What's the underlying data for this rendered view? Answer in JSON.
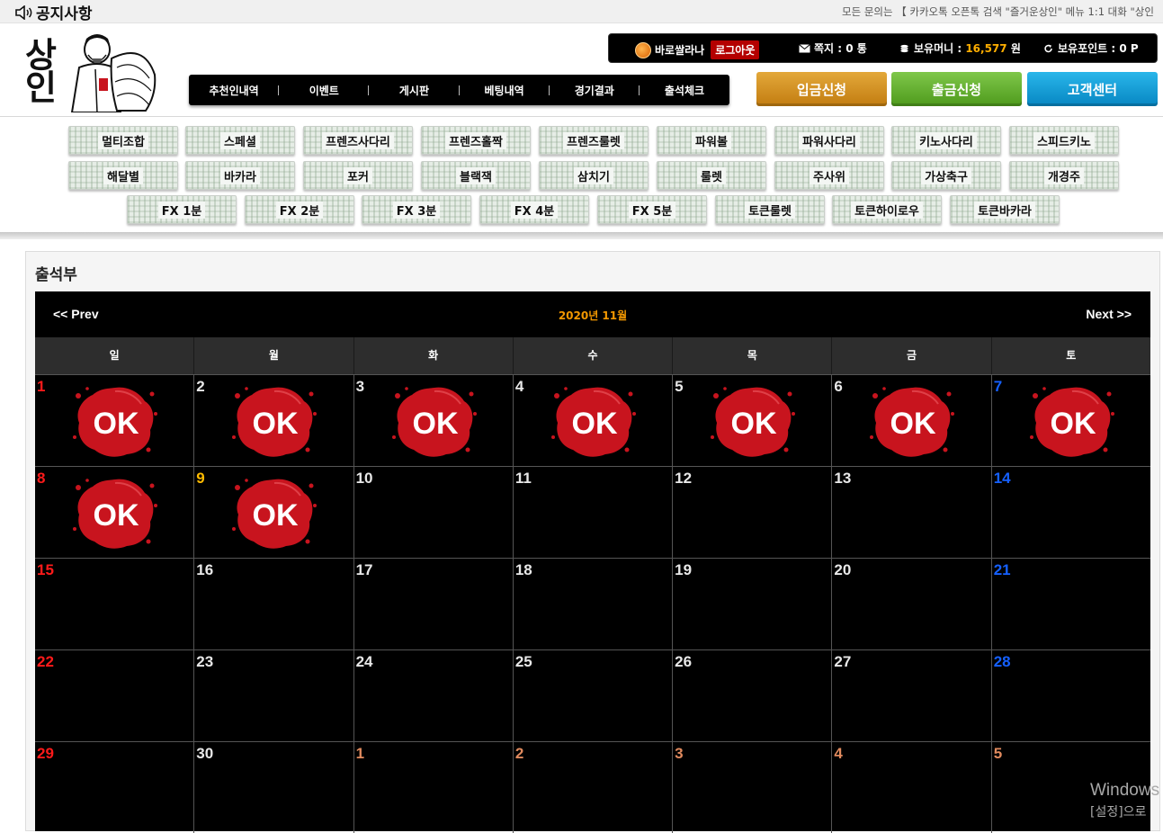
{
  "notice": {
    "title": "공지사항",
    "icon": "speaker-icon",
    "marquee": "모든 문의는 【 카카오톡 오픈톡 검색 \"즐거운상인\" 메뉴 1:1 대화 \"상인"
  },
  "logo": {
    "text": "상인",
    "icon": "merchant-logo-icon"
  },
  "userbar": {
    "username": "바로쌀라나",
    "logout_label": "로그아웃",
    "messages_label": "쪽지 : 0 통",
    "money_label": "보유머니 : ",
    "money_value": "16,577",
    "money_unit": " 원",
    "points_label": "보유포인트 : 0 P"
  },
  "nav": {
    "items": [
      "추천인내역",
      "이벤트",
      "게시판",
      "베팅내역",
      "경기결과",
      "출석체크"
    ]
  },
  "buttons": {
    "deposit": "입금신청",
    "withdraw": "출금신청",
    "support": "고객센터"
  },
  "games": {
    "row1": [
      "멀티조합",
      "스페셜",
      "프렌즈사다리",
      "프렌즈홀짝",
      "프렌즈룰렛",
      "파워볼",
      "파워사다리",
      "키노사다리",
      "스피드키노"
    ],
    "row2": [
      "해달별",
      "바카라",
      "포커",
      "블랙잭",
      "삼치기",
      "룰렛",
      "주사위",
      "가상축구",
      "개경주"
    ],
    "row3": [
      "FX 1분",
      "FX 2분",
      "FX 3분",
      "FX 4분",
      "FX 5분",
      "토큰룰렛",
      "토큰하이로우",
      "토큰바카라"
    ]
  },
  "page": {
    "title": "출석부"
  },
  "calendar": {
    "prev": "<< Prev",
    "next": "Next >>",
    "month": "2020년 11월",
    "weekdays": [
      "일",
      "월",
      "화",
      "수",
      "목",
      "금",
      "토"
    ],
    "stamp_label": "OK",
    "weeks": [
      [
        {
          "d": "1",
          "c": "red",
          "ok": true
        },
        {
          "d": "2",
          "c": "white",
          "ok": true
        },
        {
          "d": "3",
          "c": "white",
          "ok": true
        },
        {
          "d": "4",
          "c": "white",
          "ok": true
        },
        {
          "d": "5",
          "c": "white",
          "ok": true
        },
        {
          "d": "6",
          "c": "white",
          "ok": true
        },
        {
          "d": "7",
          "c": "blue",
          "ok": true
        }
      ],
      [
        {
          "d": "8",
          "c": "red",
          "ok": true
        },
        {
          "d": "9",
          "c": "yellow",
          "ok": true
        },
        {
          "d": "10",
          "c": "white",
          "ok": false
        },
        {
          "d": "11",
          "c": "white",
          "ok": false
        },
        {
          "d": "12",
          "c": "white",
          "ok": false
        },
        {
          "d": "13",
          "c": "white",
          "ok": false
        },
        {
          "d": "14",
          "c": "blue",
          "ok": false
        }
      ],
      [
        {
          "d": "15",
          "c": "red",
          "ok": false
        },
        {
          "d": "16",
          "c": "white",
          "ok": false
        },
        {
          "d": "17",
          "c": "white",
          "ok": false
        },
        {
          "d": "18",
          "c": "white",
          "ok": false
        },
        {
          "d": "19",
          "c": "white",
          "ok": false
        },
        {
          "d": "20",
          "c": "white",
          "ok": false
        },
        {
          "d": "21",
          "c": "blue",
          "ok": false
        }
      ],
      [
        {
          "d": "22",
          "c": "red",
          "ok": false
        },
        {
          "d": "23",
          "c": "white",
          "ok": false
        },
        {
          "d": "24",
          "c": "white",
          "ok": false
        },
        {
          "d": "25",
          "c": "white",
          "ok": false
        },
        {
          "d": "26",
          "c": "white",
          "ok": false
        },
        {
          "d": "27",
          "c": "white",
          "ok": false
        },
        {
          "d": "28",
          "c": "blue",
          "ok": false
        }
      ],
      [
        {
          "d": "29",
          "c": "red",
          "ok": false
        },
        {
          "d": "30",
          "c": "white",
          "ok": false
        },
        {
          "d": "1",
          "c": "muted",
          "ok": false
        },
        {
          "d": "2",
          "c": "muted",
          "ok": false
        },
        {
          "d": "3",
          "c": "muted",
          "ok": false
        },
        {
          "d": "4",
          "c": "muted",
          "ok": false
        },
        {
          "d": "5",
          "c": "muted",
          "ok": false
        }
      ]
    ]
  },
  "watermark": {
    "line1": "Windows",
    "line2": "[설정]으로"
  },
  "colors": {
    "accent_orange": "#f39800",
    "sunday_red": "#ff1a1a",
    "saturday_blue": "#1560ff",
    "deposit": "#c27c10",
    "withdraw": "#4e9a1c",
    "support": "#0786c2",
    "stamp_red": "#c8141e"
  }
}
